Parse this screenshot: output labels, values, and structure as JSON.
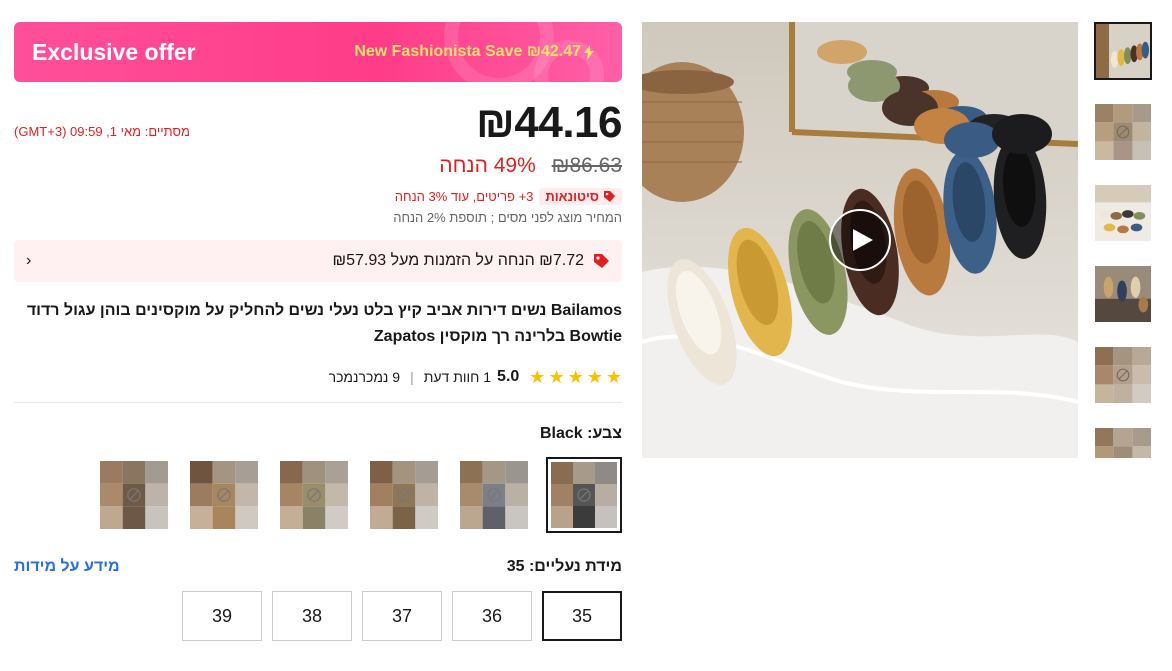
{
  "banner": {
    "title": "Exclusive offer",
    "save_text": "New Fashionista Save ₪42.47"
  },
  "price": {
    "current": "₪44.16",
    "original": "₪86.63",
    "discount": "49% הנחה",
    "timer": "מסתיים:  מאי 1, 09:59 (GMT+3)"
  },
  "wholesale": {
    "badge": "סיטונאות",
    "text": "3+ פריטים, עוד 3% הנחה"
  },
  "tax_note": "המחיר מוצג לפני מסים ; תוספת 2% הנחה",
  "coupon": {
    "text": "₪7.72 הנחה על הזמנות מעל ₪57.93"
  },
  "product": {
    "title": "Bailamos נשים דירות אביב קיץ בלט נעלי נשים להחליק על מוקסינים בוהן עגול רדוד Bowtie בלרינה רך מוקסין Zapatos"
  },
  "rating": {
    "value": "5.0",
    "reviews": "1 חוות דעת",
    "sold": "9 נמכרנמכר",
    "stars": 5
  },
  "color": {
    "label": "צבע: Black",
    "selected_index": 0,
    "count": 6
  },
  "size": {
    "label": "מידת נעליים: 35",
    "guide": "מידע על מידות",
    "options": [
      "35",
      "36",
      "37",
      "38",
      "39"
    ],
    "selected": "35"
  },
  "colors": {
    "accent": "#ff3c88",
    "price_red": "#e02020",
    "link_blue": "#2b6de6",
    "star": "#fdbf00"
  }
}
